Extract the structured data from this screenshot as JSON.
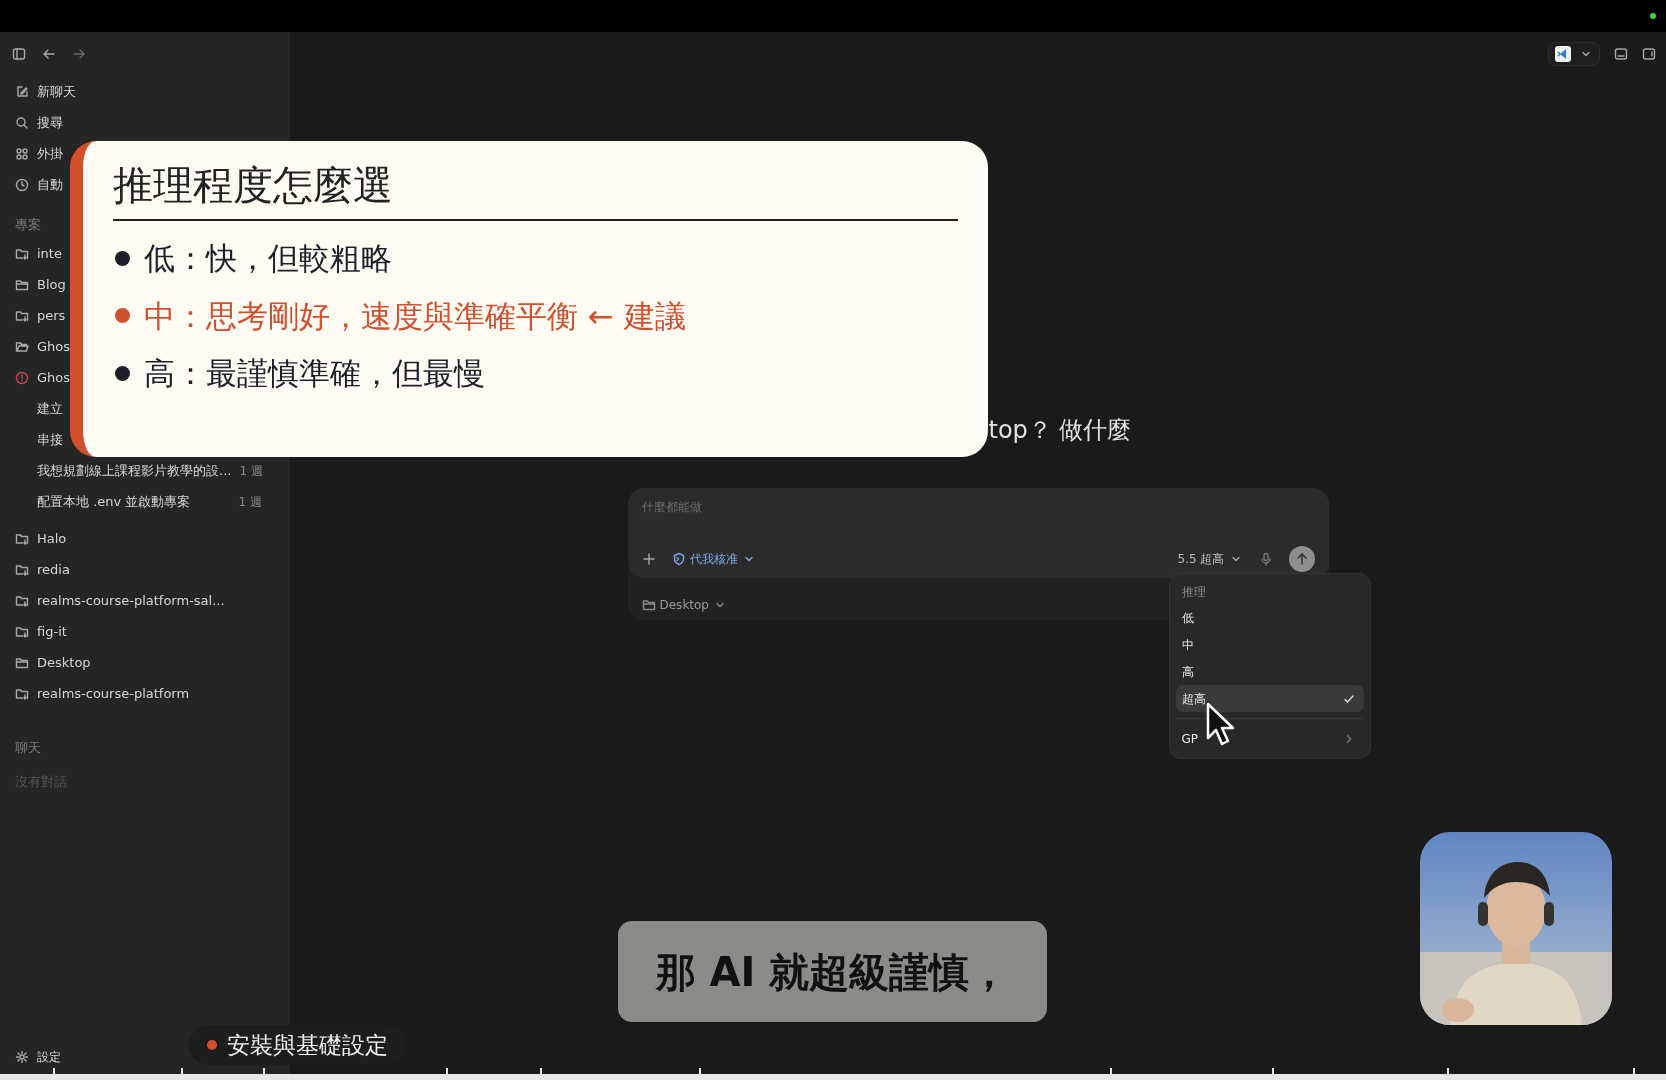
{
  "sidebar": {
    "actions": [
      {
        "label": "新聊天",
        "kind": "compose"
      },
      {
        "label": "搜尋",
        "kind": "search"
      },
      {
        "label": "外掛",
        "kind": "plugins"
      },
      {
        "label": "自動",
        "kind": "clock"
      }
    ],
    "projects_header": "專案",
    "projects": [
      {
        "label": "inte",
        "kind": "repo"
      },
      {
        "label": "Blog",
        "kind": "folder"
      },
      {
        "label": "pers",
        "kind": "repo"
      },
      {
        "label": "Ghos",
        "kind": "folder-open"
      },
      {
        "label": "Ghos",
        "kind": "alert",
        "children": [
          {
            "label": "建立"
          },
          {
            "label": "串接"
          },
          {
            "label": "我想規劃線上課程影片教學的設...",
            "time": "1 週"
          },
          {
            "label": "配置本地 .env 並啟動專案",
            "time": "1 週"
          }
        ]
      },
      {
        "label": "Halo",
        "kind": "repo"
      },
      {
        "label": "redia",
        "kind": "repo"
      },
      {
        "label": "realms-course-platform-sal...",
        "kind": "repo"
      },
      {
        "label": "fig-it",
        "kind": "repo"
      },
      {
        "label": "Desktop",
        "kind": "folder"
      },
      {
        "label": "realms-course-platform",
        "kind": "repo"
      }
    ],
    "chats_header": "聊天",
    "chats_empty": "沒有對話",
    "settings": "設定"
  },
  "main": {
    "heading": "top？ 做什麼",
    "composer": {
      "placeholder": "什麼都能做",
      "permission": "代我核准",
      "model": "5.5 超高",
      "folder": "Desktop"
    },
    "menu": {
      "header": "推理",
      "items": [
        {
          "label": "低",
          "selected": false
        },
        {
          "label": "中",
          "selected": false
        },
        {
          "label": "高",
          "selected": false
        },
        {
          "label": "超高",
          "selected": true
        }
      ],
      "submenu": "GP"
    }
  },
  "slide": {
    "title": "推理程度怎麼選",
    "bullets": [
      {
        "text": "低：快，但較粗略",
        "color": "#1e1e2a"
      },
      {
        "text": "中：思考剛好，速度與準確平衡 ← 建議",
        "color": "#d0502f"
      },
      {
        "text": "高：最謹慎準確，但最慢",
        "color": "#1e1e2a"
      }
    ]
  },
  "caption": "那 AI 就超級謹慎，",
  "chapter": "安裝與基礎設定"
}
